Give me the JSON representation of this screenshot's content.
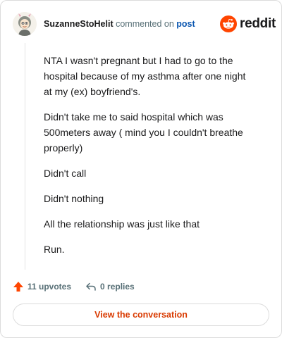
{
  "header": {
    "username": "SuzanneStoHelit",
    "action_text": "commented on",
    "post_link": "post",
    "brand_name": "reddit"
  },
  "comment": {
    "paragraphs": [
      "NTA I wasn't pregnant but I had to go to the hospital because of my asthma after one night at my (ex) boyfriend's.",
      "Didn't take me to said hospital which was 500meters away ( mind you I couldn't breathe properly)",
      "Didn't call",
      "Didn't nothing",
      "All the relationship was just like that",
      "Run."
    ]
  },
  "actions": {
    "upvotes_label": "11 upvotes",
    "replies_label": "0 replies"
  },
  "cta": {
    "label": "View the conversation"
  },
  "colors": {
    "brand": "#ff4500",
    "link": "#0a56b0",
    "cta_text": "#d93a00",
    "muted": "#576f76"
  },
  "icons": [
    "avatar",
    "reddit-logo-icon",
    "upvote-arrow-icon",
    "reply-arrow-icon"
  ]
}
